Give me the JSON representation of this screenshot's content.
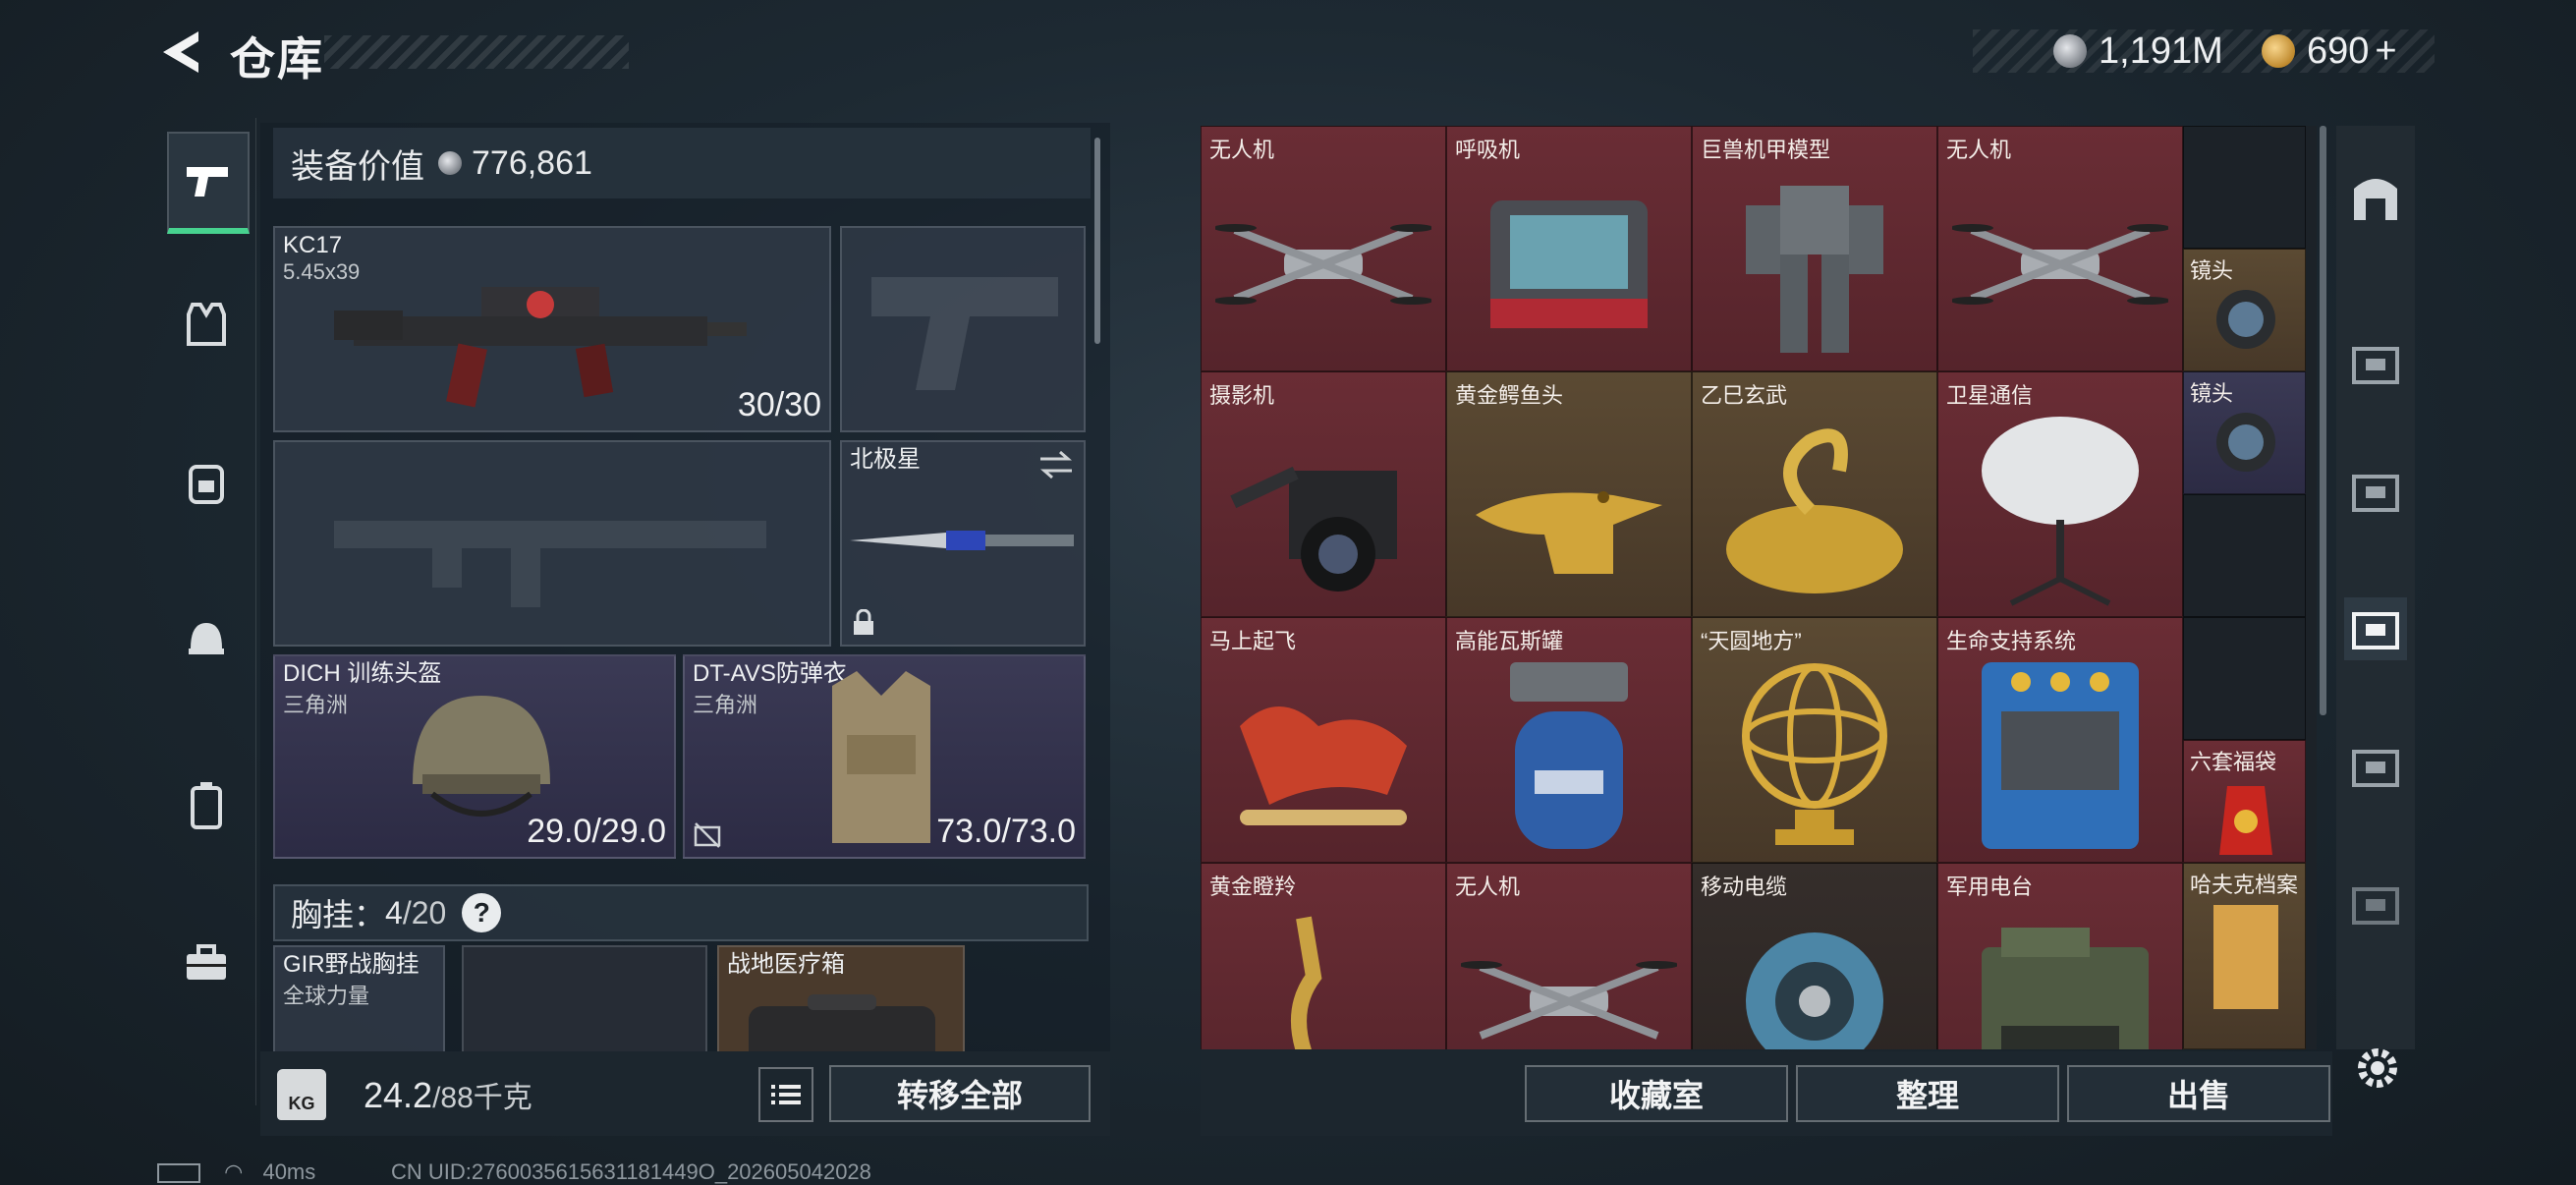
{
  "header": {
    "title": "仓库",
    "back_icon": "back-arrow-icon"
  },
  "currency": {
    "silver": "1,191M",
    "gold": "690",
    "gold_add": "+"
  },
  "equipment": {
    "value_label": "装备价值",
    "value": "776,861",
    "primary": {
      "name": "KC17",
      "caliber": "5.45x39",
      "ammo": "30/30"
    },
    "melee": {
      "name": "北极星"
    },
    "helmet": {
      "name": "DICH 训练头盔",
      "maker": "三角洲",
      "durability": "29.0/29.0"
    },
    "armor": {
      "name": "DT-AVS防弹衣",
      "maker": "三角洲",
      "durability": "73.0/73.0"
    },
    "chest_rig": {
      "label": "胸挂：",
      "used": "4",
      "total": "/20",
      "help": "?"
    },
    "rig_item": {
      "name": "GIR野战胸挂",
      "maker": "全球力量"
    },
    "medkit": {
      "name": "战地医疗箱"
    }
  },
  "weight": {
    "icon_label": "KG",
    "current": "24.2",
    "max": "/88千克"
  },
  "buttons": {
    "transfer_all": "转移全部",
    "collection": "收藏室",
    "sort": "整理",
    "sell": "出售"
  },
  "storage": {
    "items": [
      {
        "name": "无人机"
      },
      {
        "name": "呼吸机"
      },
      {
        "name": "巨兽机甲模型"
      },
      {
        "name": "无人机"
      },
      {
        "name": "摄影机"
      },
      {
        "name": "黄金鳄鱼头"
      },
      {
        "name": "乙巳玄武"
      },
      {
        "name": "卫星通信"
      },
      {
        "name": "马上起飞"
      },
      {
        "name": "高能瓦斯罐"
      },
      {
        "name": "“天圆地方”"
      },
      {
        "name": "生命支持系统"
      },
      {
        "name": "黄金瞪羚"
      },
      {
        "name": "无人机"
      },
      {
        "name": "移动电缆"
      },
      {
        "name": "军用电台"
      }
    ],
    "small_items": [
      {
        "name": "镜头"
      },
      {
        "name": "镜头"
      },
      {
        "name": "六套福袋"
      },
      {
        "name": "哈夫克档案"
      }
    ]
  },
  "status": {
    "ping": "40ms",
    "uid": "CN UID:2760035615631181449O_202605042028"
  }
}
